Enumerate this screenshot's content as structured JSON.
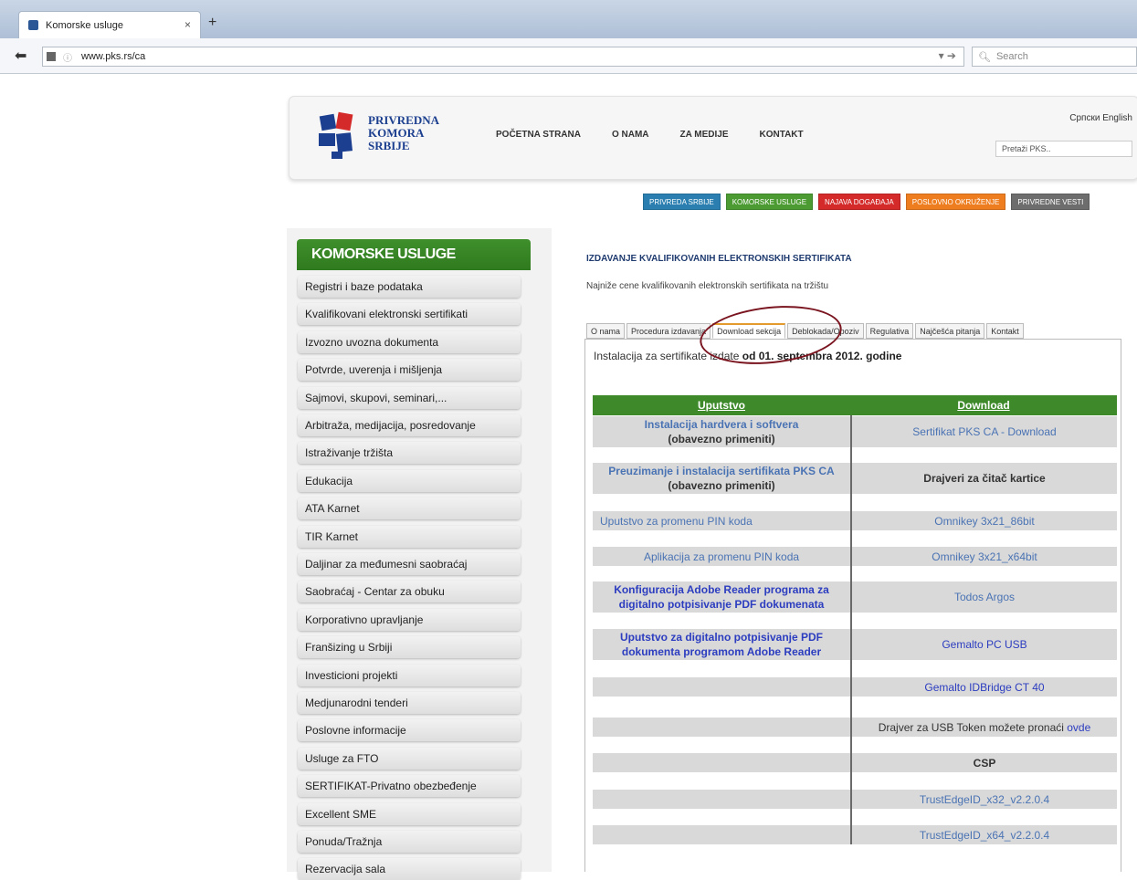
{
  "browser": {
    "tab_title": "Komorske usluge",
    "tab_close": "×",
    "new_tab": "+",
    "url": "www.pks.rs/ca",
    "search_placeholder": "Search"
  },
  "site": {
    "logo_lines": [
      "PRIVREDNA",
      "KOMORA",
      "SRBIJE"
    ],
    "nav": [
      "POČETNA STRANA",
      "O NAMA",
      "ZA MEDIJE",
      "KONTAKT"
    ],
    "lang": "Српски English",
    "search_placeholder": "Pretaži PKS..",
    "color_tabs": [
      {
        "label": "PRIVREDA SRBIJE",
        "color": "#2a7fb0"
      },
      {
        "label": "KOMORSKE USLUGE",
        "color": "#4b9a32"
      },
      {
        "label": "NAJAVA DOGAĐAJA",
        "color": "#d42a2a"
      },
      {
        "label": "POSLOVNO OKRUŽENJE",
        "color": "#ee7d1f"
      },
      {
        "label": "PRIVREDNE VESTI",
        "color": "#6d6d6d"
      }
    ]
  },
  "sidebar": {
    "title": "KOMORSKE USLUGE",
    "items": [
      "Registri i baze podataka",
      "Kvalifikovani elektronski sertifikati",
      "Izvozno uvozna dokumenta",
      "Potvrde, uverenja i mišljenja",
      "Sajmovi, skupovi, seminari,...",
      "Arbitraža, medijacija, posredovanje",
      "Istraživanje tržišta",
      "Edukacija",
      "ATA Karnet",
      "TIR Karnet",
      "Daljinar za međumesni saobraćaj",
      "Saobraćaj - Centar za obuku",
      "Korporativno upravljanje",
      "Franšizing u Srbiji",
      "Investicioni projekti",
      "Medjunarodni tenderi",
      "Poslovne informacije",
      "Usluge za FTO",
      "SERTIFIKAT-Privatno obezbeđenje",
      "Excellent SME",
      "Ponuda/Tražnja",
      "Rezervacija sala"
    ]
  },
  "main": {
    "heading": "IZDAVANJE KVALIFIKOVANIH ELEKTRONSKIH SERTIFIKATA",
    "subtitle": "Najniže cene kvalifikovanih elektronskih sertifikata na tržištu",
    "tabs": [
      "O nama",
      "Procedura izdavanja",
      "Download sekcija",
      "Deblokada/Opoziv",
      "Regulativa",
      "Najčešća pitanja",
      "Kontakt"
    ],
    "active_tab": "Download sekcija",
    "install_text": "Instalacija za sertifikate izdate ",
    "install_bold": "od 01. septembra 2012. godine",
    "table_headers": [
      "Uputstvo",
      "Download"
    ],
    "rows": [
      {
        "left": "Instalacija hardvera i softvera",
        "left2": "(obavezno primeniti)",
        "right": "Sertifikat PKS CA - Download"
      },
      {
        "left": "Preuzimanje i instalacija sertifikata PKS CA",
        "left2": "(obavezno primeniti)",
        "right": "Drajveri za čitač kartice"
      },
      {
        "left": "Uputstvo za promenu PIN koda",
        "right": "Omnikey 3x21_86bit"
      },
      {
        "left": "Aplikacija za promenu PIN koda",
        "right": "Omnikey 3x21_x64bit"
      },
      {
        "left": "Konfiguracija Adobe Reader programa za digitalno potpisivanje PDF dokumenata",
        "right": "Todos Argos"
      },
      {
        "left": "Uputstvo za digitalno potpisivanje PDF dokumenta programom Adobe Reader",
        "right": "Gemalto PC USB"
      },
      {
        "left": "",
        "right": "Gemalto IDBridge CT 40"
      },
      {
        "left": "",
        "right": "Drajver za USB Token možete pronaći ",
        "right_link": "ovde"
      },
      {
        "left": "",
        "right": "CSP"
      },
      {
        "left": "",
        "right": "TrustEdgeID_x32_v2.2.0.4"
      },
      {
        "left": "",
        "right": "TrustEdgeID_x64_v2.2.0.4"
      }
    ]
  }
}
